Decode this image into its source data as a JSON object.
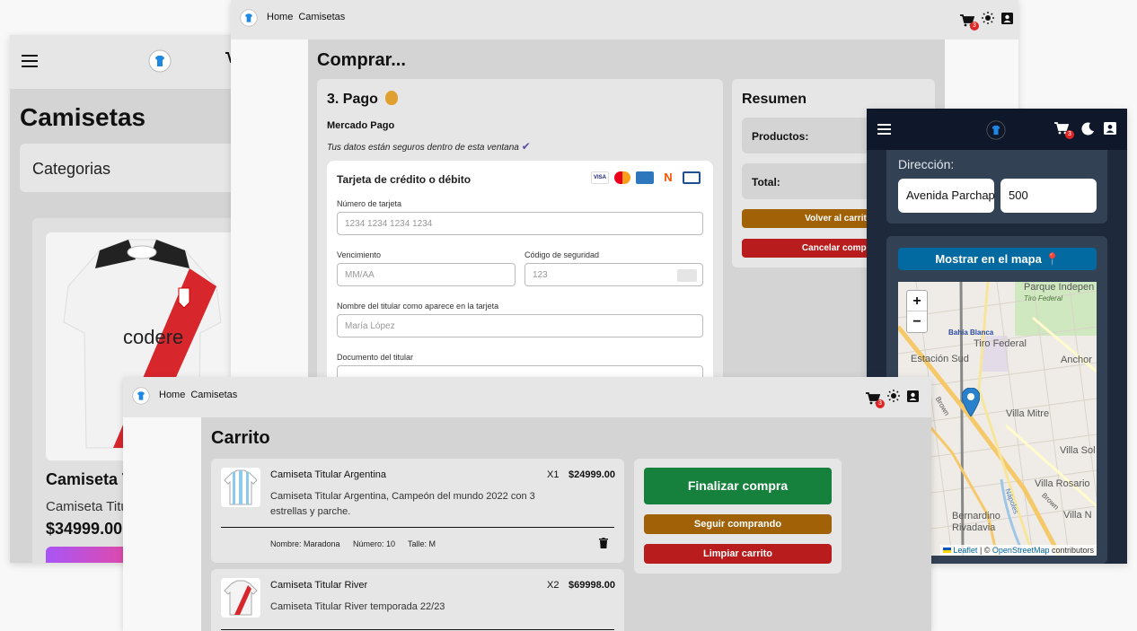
{
  "colors": {
    "page_bg": "#f8f8f8",
    "green": "#16803d",
    "brown": "#a16207",
    "red": "#b91c1c",
    "blue": "#0369a1",
    "badge": "#dc2626",
    "dark_bg": "#1e293b"
  },
  "icons": [
    "menu-icon",
    "cart-icon",
    "sun-icon",
    "moon-icon",
    "user-icon",
    "money-bag-icon",
    "checkmark-icon",
    "trash-icon",
    "pin-icon",
    "map-marker-icon"
  ],
  "cart_count": "3",
  "catalog_mobile": {
    "title": "Camisetas",
    "categories_label": "Categorias",
    "product": {
      "name": "Camiseta T",
      "desc": "Camiseta Titul",
      "price": "$34999.00"
    }
  },
  "checkout": {
    "nav": {
      "home": "Home",
      "camisetas": "Camisetas"
    },
    "title": "Comprar...",
    "payment": {
      "heading": "3. Pago",
      "method": "Mercado Pago",
      "secure_note": "Tus datos están seguros dentro de esta ventana",
      "card_title": "Tarjeta de crédito o débito",
      "card_number_label": "Número de tarjeta",
      "card_number_ph": "1234 1234 1234 1234",
      "expiry_label": "Vencimiento",
      "expiry_ph": "MM/AA",
      "cvv_label": "Código de seguridad",
      "cvv_ph": "123",
      "holder_label": "Nombre del titular como aparece en la tarjeta",
      "holder_ph": "María López",
      "doc_label": "Documento del titular"
    },
    "summary": {
      "heading": "Resumen",
      "products_label": "Productos:",
      "total_label": "Total:",
      "back_btn": "Volver al carrito",
      "cancel_btn": "Cancelar compra"
    }
  },
  "address_mobile": {
    "direccion_label": "Dirección:",
    "street": "Avenida Parchappe",
    "number": "500",
    "map_button": "Mostrar en el mapa",
    "zoom_in": "+",
    "zoom_out": "−",
    "map_labels": [
      "Parque Indepen",
      "Tiro Federal",
      "Bahía Blanca",
      "Tiro Federal",
      "Estación Sud",
      "Anchor",
      "Villa Mitre",
      "Villa Sol",
      "Villa Rosario",
      "Villa N",
      "Bernardino Rivadavia",
      "Brown",
      "Brown",
      "Nápoles"
    ],
    "attribution_leaflet": "Leaflet",
    "attribution_sep": " | © ",
    "attribution_osm": "OpenStreetMap",
    "attribution_tail": " contributors"
  },
  "cart": {
    "nav": {
      "home": "Home",
      "camisetas": "Camisetas"
    },
    "title": "Carrito",
    "items": [
      {
        "name": "Camiseta Titular Argentina",
        "qty": "X1",
        "price": "$24999.00",
        "desc": "Camiseta Titular Argentina, Campeón del mundo 2022 con 3 estrellas y parche.",
        "meta_nombre": "Nombre: Maradona",
        "meta_numero": "Número: 10",
        "meta_talle": "Talle: M"
      },
      {
        "name": "Camiseta Titular River",
        "qty": "X2",
        "price": "$69998.00",
        "desc": "Camiseta Titular River temporada 22/23"
      }
    ],
    "actions": {
      "finish": "Finalizar compra",
      "continue": "Seguir comprando",
      "clear": "Limpiar carrito"
    }
  }
}
